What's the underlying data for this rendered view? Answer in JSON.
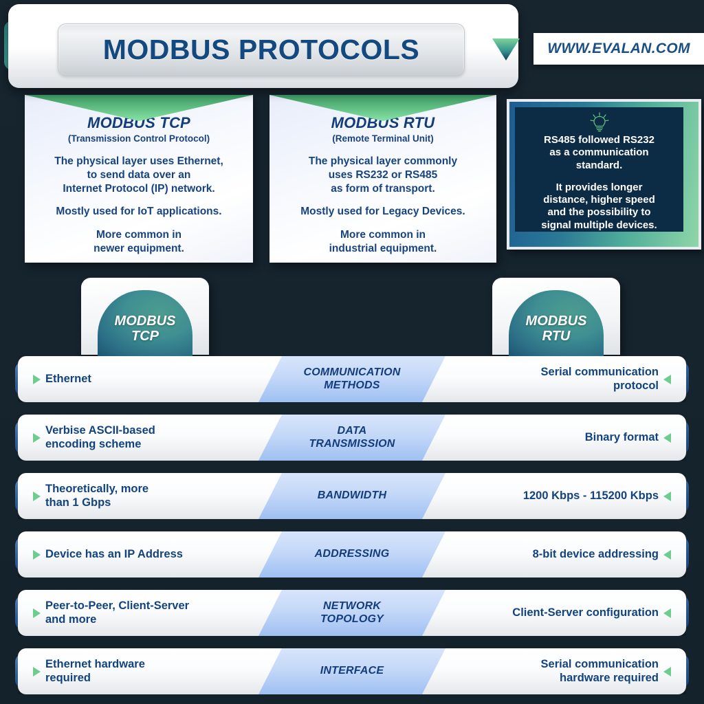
{
  "header": {
    "title": "MODBUS PROTOCOLS",
    "website": "WWW.EVALAN.COM",
    "caret_icon": "chevron-down-icon"
  },
  "cards": [
    {
      "title": "MODBUS TCP",
      "subtitle": "(Transmission Control Protocol)",
      "p1": "The physical layer uses Ethernet,\nto send data over an\nInternet Protocol (IP) network.",
      "p2": "Mostly used for IoT applications.",
      "p3": "More common in\nnewer equipment."
    },
    {
      "title": "MODBUS RTU",
      "subtitle": "(Remote Terminal Unit)",
      "p1": "The physical layer commonly\nuses RS232 or RS485\nas form of transport.",
      "p2": "Mostly used for Legacy Devices.",
      "p3": "More common in\nindustrial equipment."
    }
  ],
  "tip": {
    "icon": "lightbulb-icon",
    "text1": "RS485 followed RS232\nas a communication\nstandard.",
    "text2": "It provides longer\ndistance, higher speed\nand the possibility to\nsignal multiple devices."
  },
  "badges": {
    "left": {
      "line1": "MODBUS",
      "line2": "TCP"
    },
    "right": {
      "line1": "MODBUS",
      "line2": "RTU"
    }
  },
  "comparison": {
    "left_column": "MODBUS TCP",
    "right_column": "MODBUS RTU",
    "rows": [
      {
        "category": "COMMUNICATION\nMETHODS",
        "tcp": "Ethernet",
        "rtu": "Serial communication\nprotocol"
      },
      {
        "category": "DATA\nTRANSMISSION",
        "tcp": "Verbise ASCII-based\nencoding scheme",
        "rtu": "Binary format"
      },
      {
        "category": "BANDWIDTH",
        "tcp": "Theoretically, more\nthan 1 Gbps",
        "rtu": "1200 Kbps - 115200 Kbps"
      },
      {
        "category": "ADDRESSING",
        "tcp": "Device has an IP Address",
        "rtu": "8-bit device addressing"
      },
      {
        "category": "NETWORK\nTOPOLOGY",
        "tcp": "Peer-to-Peer, Client-Server\nand more",
        "rtu": "Client-Server configuration"
      },
      {
        "category": "INTERFACE",
        "tcp": "Ethernet hardware\nrequired",
        "rtu": "Serial communication\nhardware required"
      }
    ]
  },
  "colors": {
    "background": "#16242e",
    "title_blue": "#13497e",
    "text_blue": "#12437f",
    "accent_green": "#6dcc8e",
    "chip_blue": "#c4d8f8",
    "teal": "#3f8f93",
    "tip_navy": "#0c2b45"
  }
}
